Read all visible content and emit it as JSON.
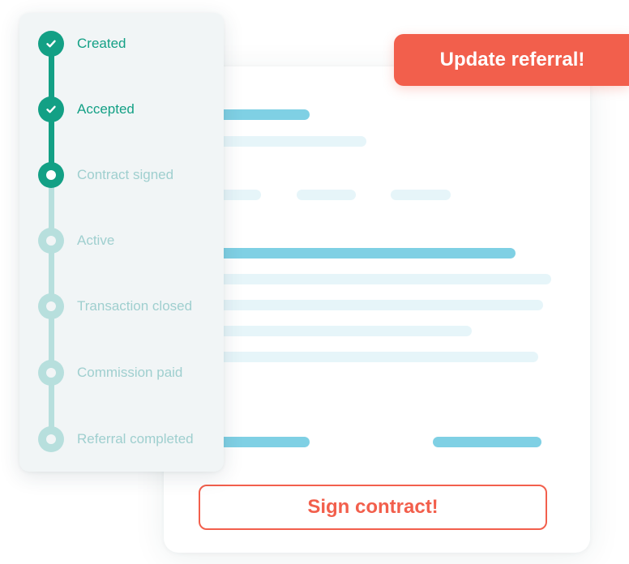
{
  "timeline": {
    "steps": [
      {
        "label": "Created",
        "state": "done",
        "icon": "check-icon"
      },
      {
        "label": "Accepted",
        "state": "done",
        "icon": "check-icon"
      },
      {
        "label": "Contract signed",
        "state": "current",
        "icon": "dot-icon"
      },
      {
        "label": "Active",
        "state": "todo",
        "icon": "dot-icon"
      },
      {
        "label": "Transaction closed",
        "state": "todo",
        "icon": "dot-icon"
      },
      {
        "label": "Commission paid",
        "state": "todo",
        "icon": "dot-icon"
      },
      {
        "label": "Referral completed",
        "state": "todo",
        "icon": "dot-icon"
      }
    ]
  },
  "actions": {
    "update_label": "Update referral!",
    "sign_label": "Sign contract!"
  },
  "colors": {
    "accent_green": "#13a085",
    "pending_green": "#b7dfdd",
    "action_red": "#f25f4c",
    "placeholder_blue": "#7fd0e4",
    "placeholder_light": "#e6f5f9",
    "panel_bg": "#f1f5f6"
  }
}
